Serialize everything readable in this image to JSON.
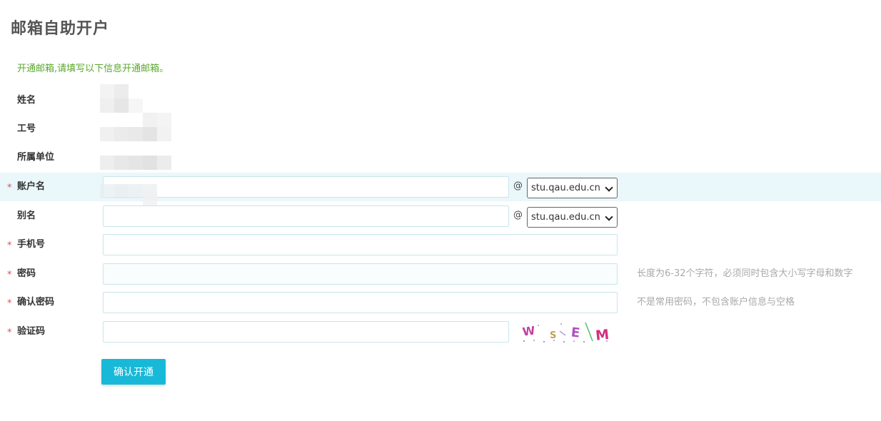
{
  "page": {
    "title": "邮箱自助开户",
    "intro": "开通邮箱,请填写以下信息开通邮箱。"
  },
  "form": {
    "required_mark": "*",
    "name": {
      "label": "姓名"
    },
    "employee_id": {
      "label": "工号"
    },
    "unit": {
      "label": "所属单位"
    },
    "account": {
      "label": "账户名",
      "value": "",
      "at": "@",
      "domain": "stu.qau.edu.cn"
    },
    "alias": {
      "label": "别名",
      "value": "",
      "at": "@",
      "domain": "stu.qau.edu.cn"
    },
    "phone": {
      "label": "手机号",
      "value": ""
    },
    "password": {
      "label": "密码",
      "value": "",
      "hint": "长度为6-32个字符，必须同时包含大小写字母和数字"
    },
    "confirm_password": {
      "label": "确认密码",
      "value": "",
      "hint": "不是常用密码，不包含账户信息与空格"
    },
    "captcha": {
      "label": "验证码",
      "value": "",
      "image_text": "WSEM"
    },
    "submit_label": "确认开通"
  },
  "colors": {
    "intro_green": "#5aa82b",
    "required_red": "#e05050",
    "button_bg": "#18b9d8",
    "highlight_row": "#eaf7fb"
  }
}
